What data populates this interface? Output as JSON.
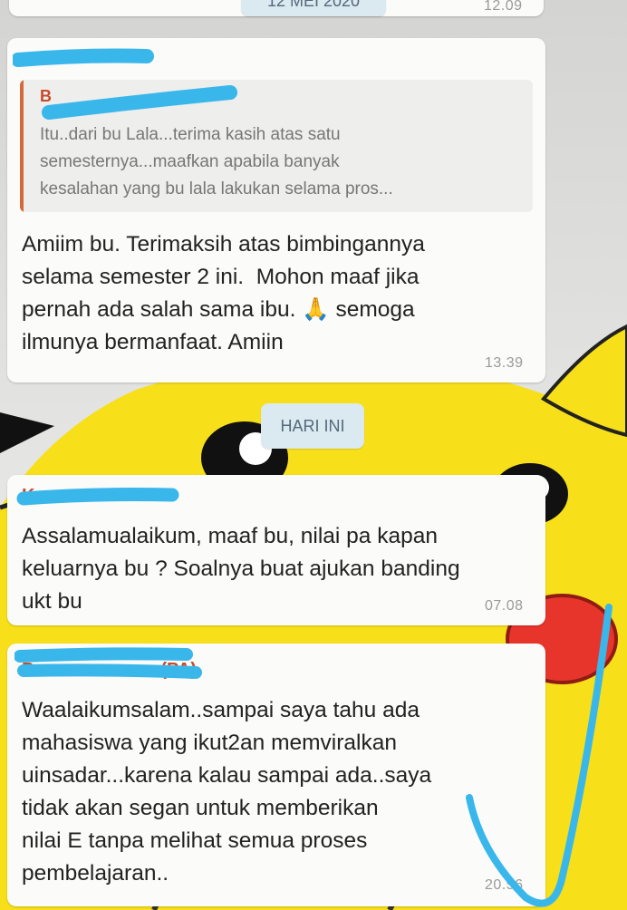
{
  "top": {
    "date_chip": "12 MEI 2020",
    "time": "12.09"
  },
  "colors": {
    "bubble": "#fbfbfa",
    "date_chip_bg": "#dbe9f1",
    "wallpaper_yellow": "#f7df1a",
    "scribble": "#3ab7ea"
  },
  "message1": {
    "quoted": {
      "sender": "B",
      "text": "Itu..dari bu Lala...terima kasih atas satu\nsemesternya...maafkan apabila banyak\nkesalahan yang bu lala lakukan selama pros..."
    },
    "text": "Amiim bu. Terimaksih atas bimbingannya\nselama semester 2 ini.  Mohon maaf jika\npernah ada salah sama ibu. 🙏 semoga\nilmunya bermanfaat. Amiin",
    "time": "13.39"
  },
  "date_today": "HARI INI",
  "message2": {
    "sender": "K",
    "text": "Assalamualaikum, maaf bu, nilai pa kapan\nkeluarnya bu ? Soalnya buat ajukan banding\nukt bu",
    "time": "07.08"
  },
  "message3": {
    "sender": "P",
    "sender_suffix": "(PA)",
    "text": "Waalaikumsalam..sampai saya tahu ada\nmahasiswa yang ikut2an memviralkan\nuinsadar...karena kalau sampai ada..saya\ntidak akan segan untuk memberikan\nnilai E tanpa melihat semua proses\npembelajaran..",
    "time": "20.56"
  }
}
